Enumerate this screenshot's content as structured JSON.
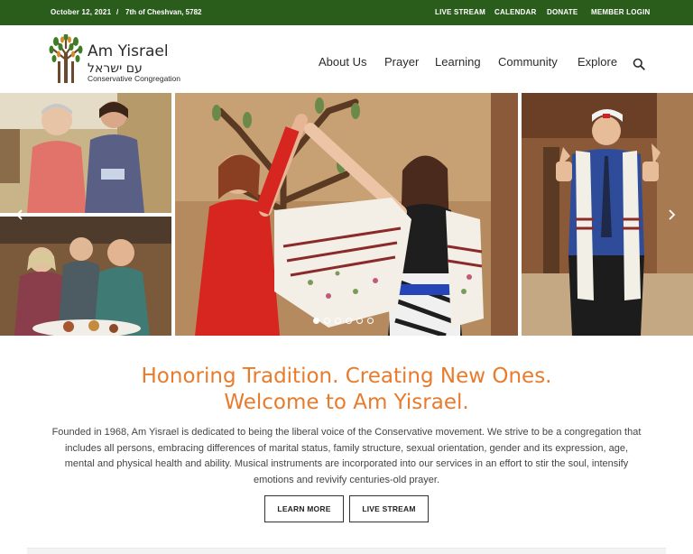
{
  "topbar": {
    "date": "October 12, 2021",
    "separator": "/",
    "hebrew_date": "7th of Cheshvan, 5782",
    "links": [
      "LIVE STREAM",
      "CALENDAR",
      "DONATE",
      "MEMBER LOGIN"
    ]
  },
  "logo": {
    "name": "Am Yisrael",
    "hebrew": "עם ישראל",
    "subtitle": "Conservative Congregation"
  },
  "nav": {
    "items": [
      "About Us",
      "Prayer",
      "Learning",
      "Community",
      "Explore"
    ]
  },
  "hero": {
    "slide_count": 6,
    "active_slide": 1
  },
  "welcome": {
    "headline_line1": "Honoring Tradition. Creating New Ones.",
    "headline_line2": "Welcome to Am Yisrael.",
    "body": "Founded in 1968, Am Yisrael is dedicated to being the liberal voice of the Conservative movement. We strive to be a congregation that includes all persons, embracing differences of marital status, family structure, sexual orientation, gender and its expression, age, mental and physical health and ability. Musical instruments are incorporated into our services in an effort to stir the soul, intensify emotions and revivify centuries-old prayer.",
    "buttons": [
      "LEARN MORE",
      "LIVE STREAM"
    ]
  },
  "colors": {
    "brand_green": "#2a5d1c",
    "accent_orange": "#e87b2c"
  },
  "icons": {
    "search": "search-icon",
    "prev": "chevron-left-icon",
    "next": "chevron-right-icon"
  }
}
